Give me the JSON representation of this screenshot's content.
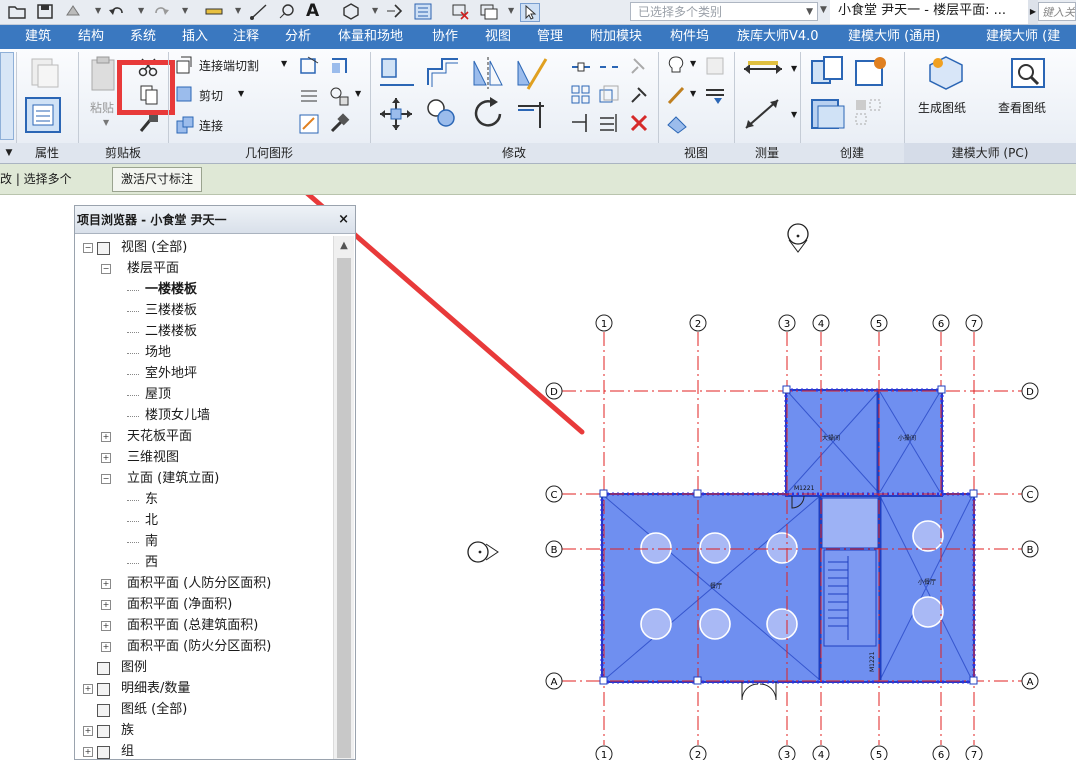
{
  "qat": {
    "selection_filter": "已选择多个类别",
    "window_title": "小食堂 尹天一 - 楼层平面: ...",
    "keyword_placeholder": "键入关"
  },
  "tabs": [
    "建筑",
    "结构",
    "系统",
    "插入",
    "注释",
    "分析",
    "体量和场地",
    "协作",
    "视图",
    "管理",
    "附加模块",
    "构件坞",
    "族库大师V4.0",
    "建模大师 (通用)",
    "建模大师 (建"
  ],
  "ribbon": {
    "paste_label": "粘贴",
    "join_cut_label": "连接端切割",
    "cut_label": "剪切",
    "join_label": "连接",
    "generate_sheet_label": "生成图纸",
    "view_sheet_label": "查看图纸",
    "panels": {
      "properties": "属性",
      "clipboard": "剪贴板",
      "geometry": "几何图形",
      "modify": "修改",
      "view": "视图",
      "measure": "测量",
      "create": "创建",
      "jianmo": "建模大师 (PC)"
    }
  },
  "options_bar": {
    "mode_text": "改 | 选择多个",
    "activate_dims_label": "激活尺寸标注"
  },
  "browser": {
    "title": "项目浏览器 - 小食堂 尹天一",
    "close": "×",
    "tree": [
      {
        "label": "视图 (全部)",
        "indent": 0,
        "expander": "-",
        "icon": true
      },
      {
        "label": "楼层平面",
        "indent": 1,
        "expander": "-"
      },
      {
        "label": "一楼楼板",
        "indent": 2,
        "bold": true
      },
      {
        "label": "三楼楼板",
        "indent": 2
      },
      {
        "label": "二楼楼板",
        "indent": 2
      },
      {
        "label": "场地",
        "indent": 2
      },
      {
        "label": "室外地坪",
        "indent": 2
      },
      {
        "label": "屋顶",
        "indent": 2
      },
      {
        "label": "楼顶女儿墙",
        "indent": 2
      },
      {
        "label": "天花板平面",
        "indent": 1,
        "expander": "+"
      },
      {
        "label": "三维视图",
        "indent": 1,
        "expander": "+"
      },
      {
        "label": "立面 (建筑立面)",
        "indent": 1,
        "expander": "-"
      },
      {
        "label": "东",
        "indent": 2
      },
      {
        "label": "北",
        "indent": 2
      },
      {
        "label": "南",
        "indent": 2
      },
      {
        "label": "西",
        "indent": 2
      },
      {
        "label": "面积平面 (人防分区面积)",
        "indent": 1,
        "expander": "+"
      },
      {
        "label": "面积平面 (净面积)",
        "indent": 1,
        "expander": "+"
      },
      {
        "label": "面积平面 (总建筑面积)",
        "indent": 1,
        "expander": "+"
      },
      {
        "label": "面积平面 (防火分区面积)",
        "indent": 1,
        "expander": "+"
      },
      {
        "label": "图例",
        "indent": 0,
        "icon": true
      },
      {
        "label": "明细表/数量",
        "indent": 0,
        "expander": "+",
        "icon": true
      },
      {
        "label": "图纸 (全部)",
        "indent": 0,
        "icon": true
      },
      {
        "label": "族",
        "indent": 0,
        "expander": "+",
        "icon": true
      },
      {
        "label": "组",
        "indent": 0,
        "expander": "+",
        "icon": true
      }
    ]
  },
  "plan": {
    "grid_top": [
      "1",
      "2",
      "3",
      "4",
      "5",
      "6",
      "7"
    ],
    "grid_side": [
      "D",
      "C",
      "B",
      "A"
    ],
    "door_tag": "M1221",
    "door_tag_2": "M1221",
    "room_1": "大操间",
    "room_2": "小操间",
    "room_3": "餐厅",
    "room_4": "小餐厅"
  },
  "colors": {
    "ribbon_tab_bg": "#3a78c0",
    "highlight_red": "#e83a3a",
    "slab_blue": "#6f8ff0",
    "grid_red": "#e02020",
    "options_bar_bg": "#dfe8d6"
  }
}
